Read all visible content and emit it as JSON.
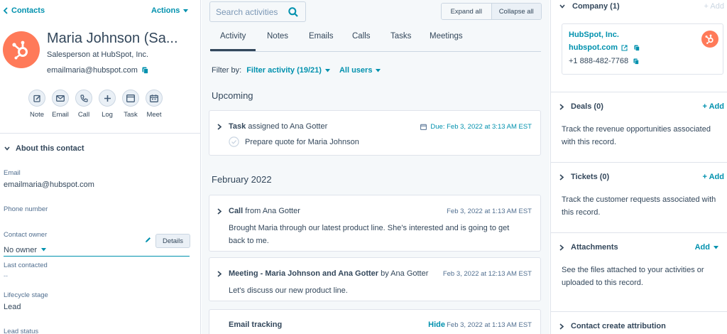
{
  "left": {
    "back_label": "Contacts",
    "actions_label": "Actions",
    "contact": {
      "name": "Maria Johnson (Sa...",
      "title": "Salesperson at HubSpot, Inc.",
      "email": "emailmaria@hubspot.com"
    },
    "quick_actions": [
      {
        "label": "Note",
        "icon": "note-icon"
      },
      {
        "label": "Email",
        "icon": "email-icon"
      },
      {
        "label": "Call",
        "icon": "call-icon"
      },
      {
        "label": "Log",
        "icon": "plus-icon"
      },
      {
        "label": "Task",
        "icon": "task-icon"
      },
      {
        "label": "Meet",
        "icon": "calendar-icon"
      }
    ],
    "about_label": "About this contact",
    "properties": {
      "email_label": "Email",
      "email_value": "emailmaria@hubspot.com",
      "phone_label": "Phone number",
      "owner_label": "Contact owner",
      "owner_value": "No owner",
      "details_label": "Details",
      "last_contacted_label": "Last contacted",
      "last_contacted_value": "--",
      "lifecycle_label": "Lifecycle stage",
      "lifecycle_value": "Lead",
      "lead_status_label": "Lead status"
    }
  },
  "middle": {
    "search_placeholder": "Search activities",
    "expand_label": "Expand all",
    "collapse_label": "Collapse all",
    "tabs": [
      "Activity",
      "Notes",
      "Emails",
      "Calls",
      "Tasks",
      "Meetings"
    ],
    "filter_by_label": "Filter by:",
    "filter_activity_label": "Filter activity (19/21)",
    "all_users_label": "All users",
    "upcoming_label": "Upcoming",
    "month_label": "February 2022",
    "task_card": {
      "title_bold": "Task",
      "title_rest": " assigned to Ana Gotter",
      "due": "Due: Feb 3, 2022 at 3:13 AM EST",
      "task_text": "Prepare quote for Maria Johnson"
    },
    "call_card": {
      "title_bold": "Call",
      "title_rest": " from Ana Gotter",
      "date": "Feb 3, 2022 at 1:13 AM EST",
      "body": "Brought Maria through our latest product line. She's interested and is going to get back to me."
    },
    "meeting_card": {
      "title_bold": "Meeting - Maria Johnson and Ana Gotter",
      "title_rest": " by Ana Gotter",
      "date": "Feb 3, 2022 at 12:13 AM EST",
      "body": "Let's discuss our new product line."
    },
    "email_card": {
      "title_bold": "Email tracking",
      "hide_label": "Hide",
      "date": "Feb 3, 2022 at 1:13 AM EST"
    }
  },
  "right": {
    "company_header": "Company (1)",
    "company_add": "+ Add",
    "company": {
      "name": "HubSpot, Inc.",
      "domain": "hubspot.com",
      "phone": "+1 888-482-7768"
    },
    "deals_header": "Deals (0)",
    "deals_add": "+ Add",
    "deals_desc": "Track the revenue opportunities associated with this record.",
    "tickets_header": "Tickets (0)",
    "tickets_add": "+ Add",
    "tickets_desc": "Track the customer requests associated with this record.",
    "attachments_header": "Attachments",
    "attachments_add": "Add",
    "attachments_desc": "See the files attached to your activities or uploaded to this record.",
    "attribution_header": "Contact create attribution"
  },
  "colors": {
    "accent": "#0091ae",
    "brand": "#ff7a59",
    "text": "#33475b"
  }
}
